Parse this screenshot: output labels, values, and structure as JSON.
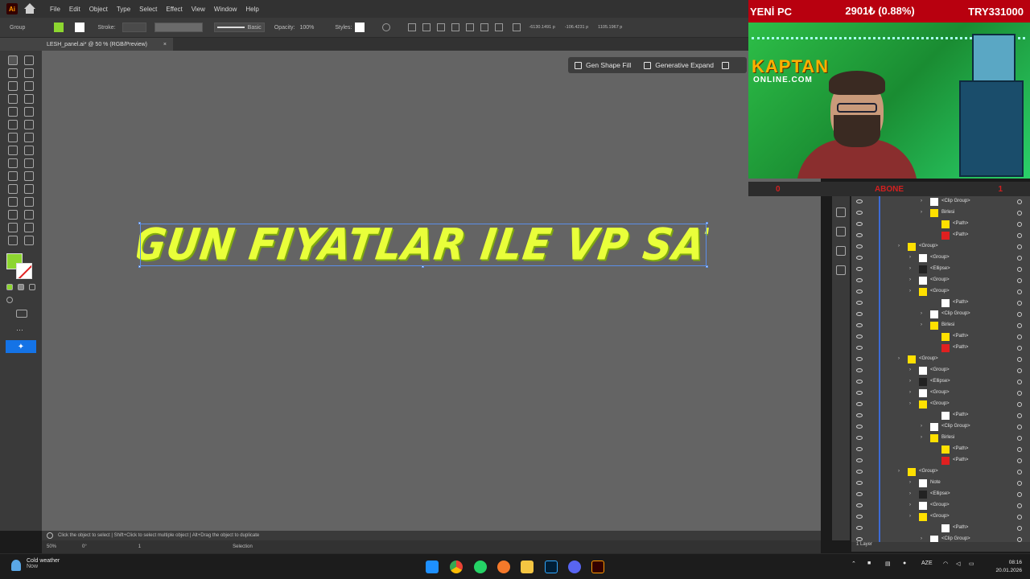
{
  "menu": [
    "File",
    "Edit",
    "Object",
    "Type",
    "Select",
    "Effect",
    "View",
    "Window",
    "Help"
  ],
  "controlbar": {
    "selection_label": "Group",
    "stroke_label": "Stroke:",
    "brush_label": "Basic",
    "opacity_label": "Opacity:",
    "opacity_value": "100%",
    "styles_label": "Styles:",
    "x_value": "-6130.1491 p",
    "y_value": "-106.4231 p",
    "w_value": "1105.1967 p",
    "fill_color": "#8dd630"
  },
  "document_tab": {
    "title": "LESH_panel.ai* @ 50 % (RGB/Preview)"
  },
  "generative": {
    "shape_fill": "Gen Shape Fill",
    "expand": "Generative Expand"
  },
  "artwork": {
    "headline": "EN UYGUN FIYATLAR ILE VP SATIN AL",
    "text_color": "#e9ff3a"
  },
  "hint": "Click the object to select  |  Shift+Click to select multiple object  |  Alt+Drag the object to duplicate",
  "status": {
    "zoom": "50%",
    "rotation": "0°",
    "artboard": "1",
    "tool": "Selection"
  },
  "layers": {
    "rows": [
      {
        "name": "<Path>",
        "level": 4,
        "color": "#ffffff"
      },
      {
        "name": "<Clip Group>",
        "level": 3,
        "color": "#ffffff"
      },
      {
        "name": "Birlesi",
        "level": 3,
        "color": "#ffe000"
      },
      {
        "name": "<Path>",
        "level": 4,
        "color": "#ffe000"
      },
      {
        "name": "<Path>",
        "level": 4,
        "color": "#e02020"
      },
      {
        "name": "<Group>",
        "level": 1,
        "color": "#ffe000"
      },
      {
        "name": "<Group>",
        "level": 2,
        "color": "#ffffff"
      },
      {
        "name": "<Ellipse>",
        "level": 2,
        "color": "#222222"
      },
      {
        "name": "<Group>",
        "level": 2,
        "color": "#ffffff"
      },
      {
        "name": "<Group>",
        "level": 2,
        "color": "#ffe000"
      },
      {
        "name": "<Path>",
        "level": 4,
        "color": "#ffffff"
      },
      {
        "name": "<Clip Group>",
        "level": 3,
        "color": "#ffffff"
      },
      {
        "name": "Birlesi",
        "level": 3,
        "color": "#ffe000"
      },
      {
        "name": "<Path>",
        "level": 4,
        "color": "#ffe000"
      },
      {
        "name": "<Path>",
        "level": 4,
        "color": "#e02020"
      },
      {
        "name": "<Group>",
        "level": 1,
        "color": "#ffe000"
      },
      {
        "name": "<Group>",
        "level": 2,
        "color": "#ffffff"
      },
      {
        "name": "<Ellipse>",
        "level": 2,
        "color": "#222222"
      },
      {
        "name": "<Group>",
        "level": 2,
        "color": "#ffffff"
      },
      {
        "name": "<Group>",
        "level": 2,
        "color": "#ffe000"
      },
      {
        "name": "<Path>",
        "level": 4,
        "color": "#ffffff"
      },
      {
        "name": "<Clip Group>",
        "level": 3,
        "color": "#ffffff"
      },
      {
        "name": "Birlesi",
        "level": 3,
        "color": "#ffe000"
      },
      {
        "name": "<Path>",
        "level": 4,
        "color": "#ffe000"
      },
      {
        "name": "<Path>",
        "level": 4,
        "color": "#e02020"
      },
      {
        "name": "<Group>",
        "level": 1,
        "color": "#ffe000"
      },
      {
        "name": "Note",
        "level": 2,
        "color": "#ffffff"
      },
      {
        "name": "<Ellipse>",
        "level": 2,
        "color": "#222222"
      },
      {
        "name": "<Group>",
        "level": 2,
        "color": "#ffffff"
      },
      {
        "name": "<Group>",
        "level": 2,
        "color": "#ffe000"
      },
      {
        "name": "<Path>",
        "level": 4,
        "color": "#ffffff"
      },
      {
        "name": "<Clip Group>",
        "level": 3,
        "color": "#ffffff"
      }
    ],
    "footer": "1 Layer"
  },
  "stream": {
    "title": "YENİ PC",
    "progress": "2901₺ (0.88%)",
    "goal": "TRY331000",
    "logo_top": "KAPTAN",
    "logo_bottom": "ONLINE.COM",
    "counter_left": "0",
    "subscribe": "ABONE",
    "counter_right": "1"
  },
  "taskbar": {
    "weather": "Cold weather",
    "weather_sub": "Now",
    "language": "AZE",
    "time": "08:16",
    "date": "20.01.2026"
  }
}
